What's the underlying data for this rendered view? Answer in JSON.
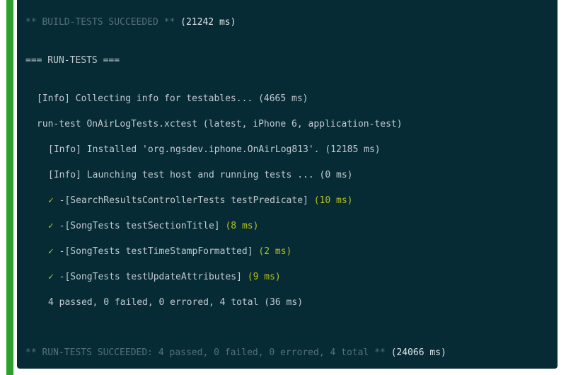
{
  "colors": {
    "accent_bar": "#2ba12b",
    "background": "#062b35",
    "text": "#c2cacf",
    "dim": "#56707a",
    "highlight": "#b5c21b"
  },
  "icons": {
    "check": "check-icon"
  },
  "log": {
    "build": {
      "status": "** BUILD-TESTS SUCCEEDED **",
      "time": "(21242 ms)"
    },
    "run_tests_header": "=== RUN-TESTS ===",
    "collecting": "[Info] Collecting info for testables... (4665 ms)",
    "run_test": "run-test OnAirLogTests.xctest (latest, iPhone 6, application-test)",
    "installed": "[Info] Installed 'org.ngsdev.iphone.OnAirLog813'. (12185 ms)",
    "launching": "[Info] Launching test host and running tests ... (0 ms)",
    "tests": [
      {
        "check": "✓",
        "name": "-[SearchResultsControllerTests testPredicate]",
        "time": "(10 ms)"
      },
      {
        "check": "✓",
        "name": "-[SongTests testSectionTitle]",
        "time": "(8 ms)"
      },
      {
        "check": "✓",
        "name": "-[SongTests testTimeStampFormatted]",
        "time": "(2 ms)"
      },
      {
        "check": "✓",
        "name": "-[SongTests testUpdateAttributes]",
        "time": "(9 ms)"
      }
    ],
    "summary": "4 passed, 0 failed, 0 errored, 4 total (36 ms)",
    "final": {
      "status": "** RUN-TESTS SUCCEEDED: 4 passed, 0 failed, 0 errored, 4 total **",
      "time": "(24066 ms)"
    }
  }
}
